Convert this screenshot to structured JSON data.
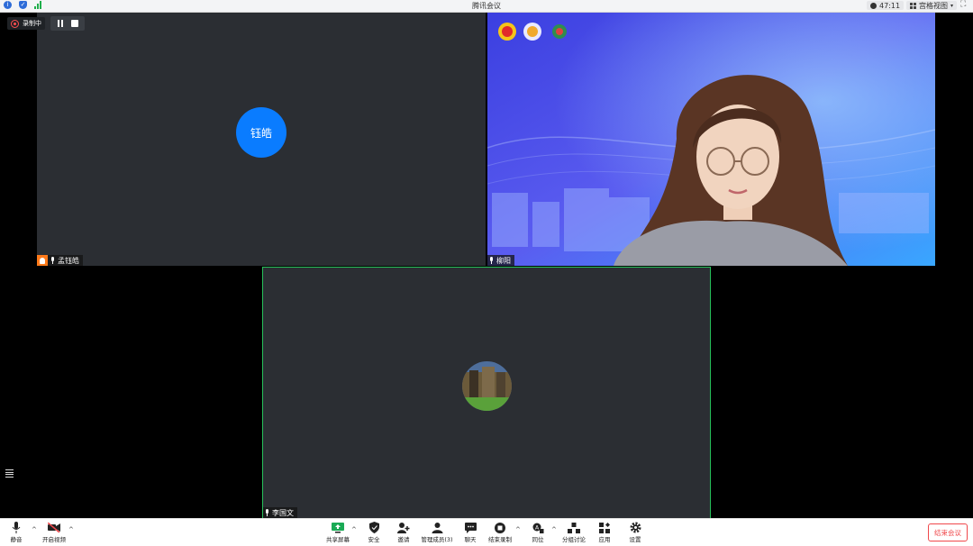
{
  "window": {
    "title": "腾讯会议",
    "timer": "47:11",
    "view_mode": "宫格视图"
  },
  "recording": {
    "label": "录制中"
  },
  "participants": [
    {
      "name": "孟钰皓",
      "avatar_text": "钰皓",
      "avatar_color": "#0a7cff",
      "is_host": true
    },
    {
      "name": "柳阳",
      "has_video": true
    },
    {
      "name": "李国文",
      "active_speaker": true
    }
  ],
  "toolbar": {
    "mute": "静音",
    "start_video": "开启视频",
    "share_screen": "共享屏幕",
    "security": "安全",
    "invite": "邀请",
    "manage_members": "管理成员(3)",
    "chat": "聊天",
    "end_recording": "结束录制",
    "interpret": "同位",
    "breakout": "分组讨论",
    "apps": "应用",
    "settings": "设置",
    "end_meeting": "结束会议"
  },
  "colors": {
    "accent_blue": "#0a7cff",
    "active_border": "#27c05a",
    "danger": "#f0484b",
    "host_badge": "#ff7a1a"
  }
}
